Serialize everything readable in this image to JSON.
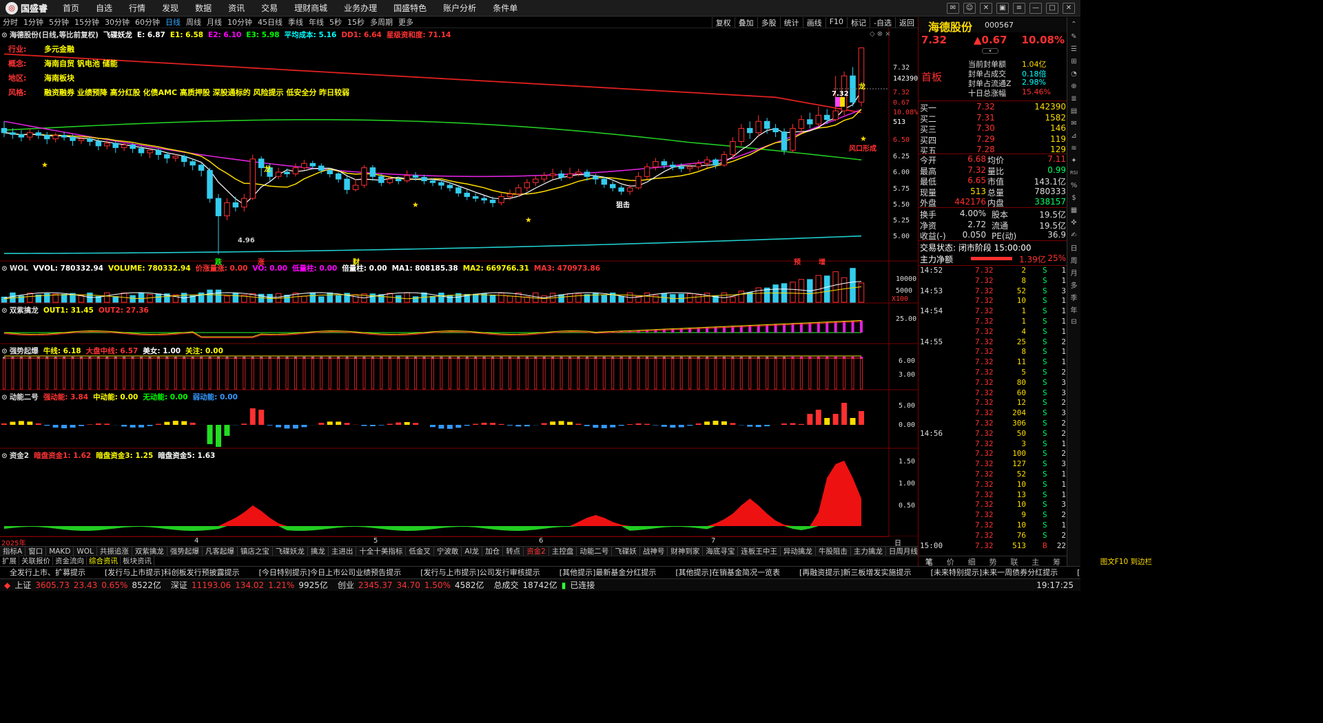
{
  "app": {
    "logo_text": "国盛睿"
  },
  "menu": [
    "首页",
    "自选",
    "行情",
    "发现",
    "数据",
    "资讯",
    "交易",
    "理财商城",
    "业务办理",
    "国盛特色",
    "账户分析",
    "条件单"
  ],
  "periods": [
    "分时",
    "1分钟",
    "5分钟",
    "15分钟",
    "30分钟",
    "60分钟",
    "日线",
    "周线",
    "月线",
    "10分钟",
    "45日线",
    "季线",
    "年线",
    "5秒",
    "15秒",
    "多周期",
    "更多"
  ],
  "active_period": "日线",
  "toolbar": [
    "复权",
    "叠加",
    "多股",
    "统计",
    "画线",
    "F10",
    "标记",
    "-自选",
    "返回"
  ],
  "main_panel": {
    "title_items": [
      {
        "text": "海德股份(日线,等比前复权)",
        "color": "#dddddd"
      },
      {
        "text": "飞碟妖龙",
        "color": "#ffffff"
      },
      {
        "text": "E: 6.87",
        "color": "#ffffff"
      },
      {
        "text": "E1: 6.58",
        "color": "#ffff00"
      },
      {
        "text": "E2: 6.10",
        "color": "#ff00ff"
      },
      {
        "text": "E3: 5.98",
        "color": "#00ff00"
      },
      {
        "text": "平均成本: 5.16",
        "color": "#00ffff"
      },
      {
        "text": "DD1: 6.64",
        "color": "#ff3333"
      },
      {
        "text": "星级资和度: 71.14",
        "color": "#ff3333"
      }
    ],
    "info": [
      {
        "k": "行业:",
        "v": "多元金融"
      },
      {
        "k": "概念:",
        "v": "海南自贸 钒电池 储能"
      },
      {
        "k": "地区:",
        "v": "海南板块"
      },
      {
        "k": "风格:",
        "v": "融资融券 业绩预降 高分红股 化债AMC 高质押股 深股通标的 风险提示 低安全分 昨日较弱"
      }
    ],
    "y_ticks": [
      "7.32",
      "142390",
      "7.32",
      "0.67",
      "10.08%",
      "513",
      "6.50",
      "6.25",
      "6.00",
      "5.75",
      "5.50",
      "5.25",
      "5.00"
    ],
    "annotations": [
      "龙",
      "4.96",
      "7.32",
      "龙",
      "风口形成",
      "狙击",
      "跌",
      "涨",
      "财",
      "预",
      "增"
    ]
  },
  "volume_panel": {
    "title_items": [
      {
        "text": "WOL",
        "color": "#dddddd"
      },
      {
        "text": "VVOL: 780332.94",
        "color": "#ffffff"
      },
      {
        "text": "VOLUME: 780332.94",
        "color": "#ffff00"
      },
      {
        "text": "价涨量涨: 0.00",
        "color": "#ff3333"
      },
      {
        "text": "VO: 0.00",
        "color": "#ff00ff"
      },
      {
        "text": "低量柱: 0.00",
        "color": "#ff00ff"
      },
      {
        "text": "倍量柱: 0.00",
        "color": "#ffffff"
      },
      {
        "text": "MA1: 808185.38",
        "color": "#ffffff"
      },
      {
        "text": "MA2: 669766.31",
        "color": "#ffff00"
      },
      {
        "text": "MA3: 470973.86",
        "color": "#ff3333"
      }
    ],
    "y_ticks": [
      "10000",
      "5000",
      "X100"
    ]
  },
  "panel2": {
    "title_items": [
      {
        "text": "双紫擒龙",
        "color": "#dddddd"
      },
      {
        "text": "OUT1: 31.45",
        "color": "#ffff00"
      },
      {
        "text": "OUT2: 27.36",
        "color": "#ff3333"
      }
    ],
    "y_ticks": [
      "25.00"
    ]
  },
  "panel3": {
    "title_items": [
      {
        "text": "强势起爆",
        "color": "#dddddd"
      },
      {
        "text": "牛线: 6.18",
        "color": "#ffff00"
      },
      {
        "text": "大盘中线: 6.57",
        "color": "#ff3333"
      },
      {
        "text": "美女: 1.00",
        "color": "#ffffff"
      },
      {
        "text": "关注: 0.00",
        "color": "#ffff00"
      }
    ],
    "y_ticks": [
      "6.00",
      "3.00"
    ]
  },
  "panel4": {
    "title_items": [
      {
        "text": "动能二号",
        "color": "#dddddd"
      },
      {
        "text": "强动能: 3.84",
        "color": "#ff3333"
      },
      {
        "text": "中动能: 0.00",
        "color": "#ffff00"
      },
      {
        "text": "无动能: 0.00",
        "color": "#00ff00"
      },
      {
        "text": "弱动能: 0.00",
        "color": "#3399ff"
      }
    ],
    "y_ticks": [
      "5.00",
      "0.00"
    ]
  },
  "panel5": {
    "title_items": [
      {
        "text": "资金2",
        "color": "#dddddd"
      },
      {
        "text": "暗盘资金1: 1.62",
        "color": "#ff3333"
      },
      {
        "text": "暗盘资金3: 1.25",
        "color": "#ffff00"
      },
      {
        "text": "暗盘资金5: 1.63",
        "color": "#ffffff"
      }
    ],
    "y_ticks": [
      "1.50",
      "1.00",
      "0.50"
    ]
  },
  "date_axis": [
    "2025年",
    "4",
    "5",
    "6",
    "7",
    "日线"
  ],
  "indicator_tabs": [
    "指标A",
    "窗口",
    "MAKD",
    "WOL",
    "共振追涨",
    "双紫擒龙",
    "强势起爆",
    "凡客起爆",
    "镇店之宝",
    "飞碟妖龙",
    "擒龙",
    "主进出",
    "十全十美指标",
    "低金叉",
    "宁波敢",
    "AI龙",
    "加仓",
    "转点",
    "资金2",
    "主控盘",
    "动能二号",
    "飞碟妖",
    "战神号",
    "财神到家",
    "海底寻宝",
    "连板王中王",
    "异动擒龙",
    "牛股阻击",
    "主力擒龙",
    "日周月线共振",
    "指标B",
    "模板"
  ],
  "active_indicator_tab": "资金2",
  "indicator_tabs2": [
    "扩展",
    "关联报价",
    "资金流向",
    "综合资讯",
    "板块资讯"
  ],
  "active_indicator_tab2": "综合资讯",
  "news": [
    "全发行上市、扩募提示",
    "[发行与上市提示]科创板发行预披露提示",
    "[今日特别提示]今日上市公司业绩预告提示",
    "[发行与上市提示]公司发行审核提示",
    "[其他提示]最新基金分红提示",
    "[其他提示]在销基金简况一览表",
    "[再融资提示]新三板增发实施提示",
    "[未来特别提示]未来一周债券分红提示",
    "[今日特别提示]今日债"
  ],
  "news_right": "图文F10 到边栏",
  "status": {
    "sh_label": "上证",
    "sh_val": "3605.73",
    "sh_chg": "23.43",
    "sh_pct": "0.65%",
    "sh_amt": "8522亿",
    "sz_label": "深证",
    "sz_val": "11193.06",
    "sz_chg": "134.02",
    "sz_pct": "1.21%",
    "sz_amt": "9925亿",
    "cy_label": "创业",
    "cy_val": "2345.37",
    "cy_chg": "34.70",
    "cy_pct": "1.50%",
    "cy_amt": "4582亿",
    "total_label": "总成交",
    "total_val": "18742亿",
    "conn": "已连接",
    "time": "19:17:25"
  },
  "quote": {
    "name": "海德股份",
    "code": "000567",
    "price": "7.32",
    "change": "▲0.67",
    "pct": "10.08%",
    "tag": "首板",
    "seal": [
      {
        "k": "当前封单额",
        "v": "1.04亿"
      },
      {
        "k": "封单占成交",
        "v": "0.18倍"
      },
      {
        "k": "封单占流通Z",
        "v": "2.98%"
      },
      {
        "k": "十日总涨幅",
        "v": "15.46%"
      }
    ],
    "bids": [
      {
        "k": "买一",
        "p": "7.32",
        "v": "142390"
      },
      {
        "k": "买二",
        "p": "7.31",
        "v": "1582"
      },
      {
        "k": "买三",
        "p": "7.30",
        "v": "146"
      },
      {
        "k": "买四",
        "p": "7.29",
        "v": "119"
      },
      {
        "k": "买五",
        "p": "7.28",
        "v": "129"
      }
    ],
    "stats": [
      {
        "k1": "今开",
        "v1": "6.68",
        "k2": "均价",
        "v2": "7.11"
      },
      {
        "k1": "最高",
        "v1": "7.32",
        "k2": "量比",
        "v2": "0.99"
      },
      {
        "k1": "最低",
        "v1": "6.65",
        "k2": "市值",
        "v2": "143.1亿"
      },
      {
        "k1": "现量",
        "v1": "513",
        "k2": "总量",
        "v2": "780333"
      },
      {
        "k1": "外盘",
        "v1": "442176",
        "k2": "内盘",
        "v2": "338157"
      }
    ],
    "stats2": [
      {
        "k1": "换手",
        "v1": "4.00%",
        "k2": "股本",
        "v2": "19.5亿"
      },
      {
        "k1": "净资",
        "v1": "2.72",
        "k2": "流通",
        "v2": "19.5亿"
      },
      {
        "k1": "收益(-)",
        "v1": "0.050",
        "k2": "PE(动)",
        "v2": "36.9"
      }
    ],
    "trade_status": "交易状态: 闭市阶段 15:00:00",
    "main_net_label": "主力净额",
    "main_net_val": "1.39亿",
    "main_net_pct": "25%",
    "ticks": [
      {
        "t": "14:52",
        "p": "7.32",
        "v": "2",
        "s": "S",
        "n": "1"
      },
      {
        "t": "",
        "p": "7.32",
        "v": "8",
        "s": "S",
        "n": "1"
      },
      {
        "t": "14:53",
        "p": "7.32",
        "v": "52",
        "s": "S",
        "n": "3"
      },
      {
        "t": "",
        "p": "7.32",
        "v": "10",
        "s": "S",
        "n": "1"
      },
      {
        "t": "14:54",
        "p": "7.32",
        "v": "1",
        "s": "S",
        "n": "1"
      },
      {
        "t": "",
        "p": "7.32",
        "v": "1",
        "s": "S",
        "n": "1"
      },
      {
        "t": "",
        "p": "7.32",
        "v": "4",
        "s": "S",
        "n": "1"
      },
      {
        "t": "14:55",
        "p": "7.32",
        "v": "25",
        "s": "S",
        "n": "2"
      },
      {
        "t": "",
        "p": "7.32",
        "v": "8",
        "s": "S",
        "n": "1"
      },
      {
        "t": "",
        "p": "7.32",
        "v": "11",
        "s": "S",
        "n": "1"
      },
      {
        "t": "",
        "p": "7.32",
        "v": "5",
        "s": "S",
        "n": "2"
      },
      {
        "t": "",
        "p": "7.32",
        "v": "80",
        "s": "S",
        "n": "3"
      },
      {
        "t": "",
        "p": "7.32",
        "v": "60",
        "s": "S",
        "n": "3"
      },
      {
        "t": "",
        "p": "7.32",
        "v": "12",
        "s": "S",
        "n": "2"
      },
      {
        "t": "",
        "p": "7.32",
        "v": "204",
        "s": "S",
        "n": "3"
      },
      {
        "t": "",
        "p": "7.32",
        "v": "306",
        "s": "S",
        "n": "2"
      },
      {
        "t": "14:56",
        "p": "7.32",
        "v": "50",
        "s": "S",
        "n": "2"
      },
      {
        "t": "",
        "p": "7.32",
        "v": "3",
        "s": "S",
        "n": "1"
      },
      {
        "t": "",
        "p": "7.32",
        "v": "100",
        "s": "S",
        "n": "2"
      },
      {
        "t": "",
        "p": "7.32",
        "v": "127",
        "s": "S",
        "n": "3"
      },
      {
        "t": "",
        "p": "7.32",
        "v": "52",
        "s": "S",
        "n": "1"
      },
      {
        "t": "",
        "p": "7.32",
        "v": "10",
        "s": "S",
        "n": "1"
      },
      {
        "t": "",
        "p": "7.32",
        "v": "13",
        "s": "S",
        "n": "1"
      },
      {
        "t": "",
        "p": "7.32",
        "v": "10",
        "s": "S",
        "n": "3"
      },
      {
        "t": "",
        "p": "7.32",
        "v": "9",
        "s": "S",
        "n": "2"
      },
      {
        "t": "",
        "p": "7.32",
        "v": "10",
        "s": "S",
        "n": "1"
      },
      {
        "t": "",
        "p": "7.32",
        "v": "76",
        "s": "S",
        "n": "2"
      },
      {
        "t": "15:00",
        "p": "7.32",
        "v": "513",
        "s": "B",
        "n": "22"
      }
    ],
    "bottom_tabs": [
      "笔",
      "价",
      "细",
      "势",
      "联",
      "主",
      "筹"
    ]
  },
  "side_buttons": [
    "⌃",
    "✎",
    "☰",
    "⊞",
    "◔",
    "⊕",
    "≣",
    "▤",
    "✉",
    "⊿",
    "≋",
    "✦",
    "RSI",
    "%",
    "$",
    "▦",
    "✜",
    "✍",
    "日",
    "周",
    "月",
    "多",
    "季",
    "年",
    "⊟"
  ],
  "chart_data": {
    "type": "candlestick",
    "ylim": [
      4.9,
      7.45
    ],
    "ma_series": [
      {
        "name": "E1",
        "color": "#ffff00"
      },
      {
        "name": "E2",
        "color": "#ff00ff"
      },
      {
        "name": "E3",
        "color": "#00ff00"
      },
      {
        "name": "平均成本",
        "color": "#00ffff"
      }
    ],
    "candles": [
      [
        6.4,
        6.35,
        6.48,
        6.3
      ],
      [
        6.35,
        6.33,
        6.4,
        6.28
      ],
      [
        6.33,
        6.3,
        6.38,
        6.25
      ],
      [
        6.3,
        6.35,
        6.4,
        6.26
      ],
      [
        6.35,
        6.32,
        6.38,
        6.28
      ],
      [
        6.32,
        6.28,
        6.36,
        6.22
      ],
      [
        6.28,
        6.32,
        6.35,
        6.24
      ],
      [
        6.32,
        6.3,
        6.36,
        6.26
      ],
      [
        6.3,
        6.26,
        6.33,
        6.2
      ],
      [
        6.26,
        6.28,
        6.32,
        6.22
      ],
      [
        6.28,
        6.25,
        6.3,
        6.2
      ],
      [
        6.25,
        6.2,
        6.28,
        6.15
      ],
      [
        6.2,
        6.23,
        6.26,
        6.16
      ],
      [
        6.23,
        6.18,
        6.25,
        6.12
      ],
      [
        6.18,
        6.21,
        6.24,
        6.14
      ],
      [
        6.21,
        6.17,
        6.23,
        6.12
      ],
      [
        6.17,
        6.12,
        6.2,
        6.08
      ],
      [
        6.12,
        6.15,
        6.18,
        6.06
      ],
      [
        6.15,
        6.1,
        6.17,
        6.04
      ],
      [
        6.1,
        6.06,
        6.13,
        6.0
      ],
      [
        6.06,
        6.08,
        6.11,
        6.02
      ],
      [
        6.08,
        6.02,
        6.1,
        5.96
      ],
      [
        6.02,
        5.98,
        6.05,
        5.92
      ],
      [
        5.98,
        5.92,
        6.0,
        5.85
      ],
      [
        5.92,
        5.6,
        5.95,
        5.55
      ],
      [
        5.6,
        5.4,
        5.65,
        4.96
      ],
      [
        5.4,
        5.55,
        5.6,
        5.35
      ],
      [
        5.55,
        5.5,
        5.62,
        5.45
      ],
      [
        5.5,
        5.6,
        5.65,
        5.45
      ],
      [
        5.6,
        6.05,
        6.1,
        5.58
      ],
      [
        6.05,
        5.95,
        6.08,
        5.85
      ],
      [
        5.95,
        5.85,
        6.0,
        5.8
      ],
      [
        5.85,
        5.9,
        5.95,
        5.82
      ],
      [
        5.9,
        5.88,
        5.94,
        5.84
      ],
      [
        5.88,
        5.95,
        6.0,
        5.85
      ],
      [
        5.95,
        6.0,
        6.04,
        5.92
      ],
      [
        6.0,
        5.97,
        6.03,
        5.93
      ],
      [
        5.97,
        5.92,
        6.0,
        5.88
      ],
      [
        5.92,
        5.88,
        5.95,
        5.84
      ],
      [
        5.88,
        5.82,
        5.9,
        5.78
      ],
      [
        5.82,
        5.7,
        5.85,
        5.65
      ],
      [
        5.7,
        5.75,
        5.82,
        5.68
      ],
      [
        5.75,
        5.95,
        5.98,
        5.72
      ],
      [
        5.95,
        5.85,
        5.98,
        5.8
      ],
      [
        5.85,
        5.78,
        5.88,
        5.74
      ],
      [
        5.78,
        5.82,
        5.86,
        5.76
      ],
      [
        5.82,
        5.8,
        5.85,
        5.76
      ],
      [
        5.8,
        5.86,
        5.92,
        5.78
      ],
      [
        5.86,
        5.84,
        5.9,
        5.8
      ],
      [
        5.84,
        5.8,
        5.87,
        5.76
      ],
      [
        5.8,
        5.78,
        5.83,
        5.74
      ],
      [
        5.78,
        5.75,
        5.81,
        5.7
      ],
      [
        5.75,
        5.72,
        5.78,
        5.68
      ],
      [
        5.72,
        5.66,
        5.75,
        5.62
      ],
      [
        5.66,
        5.62,
        5.7,
        5.58
      ],
      [
        5.62,
        5.6,
        5.66,
        5.56
      ],
      [
        5.6,
        5.58,
        5.63,
        5.54
      ],
      [
        5.58,
        5.55,
        5.62,
        5.5
      ],
      [
        5.55,
        5.62,
        5.66,
        5.52
      ],
      [
        5.62,
        5.65,
        5.7,
        5.58
      ],
      [
        5.65,
        5.72,
        5.76,
        5.62
      ],
      [
        5.72,
        5.78,
        5.82,
        5.68
      ],
      [
        5.78,
        5.82,
        5.86,
        5.74
      ],
      [
        5.82,
        5.86,
        5.9,
        5.78
      ],
      [
        5.86,
        5.88,
        5.94,
        5.82
      ],
      [
        5.88,
        5.84,
        5.92,
        5.8
      ],
      [
        5.84,
        5.88,
        5.95,
        5.82
      ],
      [
        5.88,
        5.9,
        5.94,
        5.85
      ],
      [
        5.9,
        5.85,
        5.93,
        5.8
      ],
      [
        5.85,
        5.82,
        5.88,
        5.76
      ],
      [
        5.82,
        5.76,
        5.85,
        5.72
      ],
      [
        5.76,
        5.72,
        5.8,
        5.68
      ],
      [
        5.72,
        5.68,
        5.75,
        5.64
      ],
      [
        5.68,
        5.72,
        5.76,
        5.64
      ],
      [
        5.72,
        5.85,
        5.9,
        5.7
      ],
      [
        5.85,
        5.96,
        6.0,
        5.82
      ],
      [
        5.96,
        6.02,
        6.06,
        5.92
      ],
      [
        6.02,
        5.98,
        6.05,
        5.94
      ],
      [
        5.98,
        5.96,
        6.02,
        5.92
      ],
      [
        5.96,
        5.94,
        6.0,
        5.9
      ],
      [
        5.94,
        5.96,
        6.0,
        5.9
      ],
      [
        5.96,
        6.0,
        6.04,
        5.92
      ],
      [
        6.0,
        6.04,
        6.08,
        5.95
      ],
      [
        6.04,
        5.98,
        6.06,
        5.94
      ],
      [
        5.98,
        6.1,
        6.14,
        5.96
      ],
      [
        6.1,
        6.25,
        6.3,
        6.05
      ],
      [
        6.25,
        6.4,
        6.45,
        6.2
      ],
      [
        6.4,
        6.35,
        6.48,
        6.28
      ],
      [
        6.35,
        6.48,
        6.55,
        6.3
      ],
      [
        6.48,
        6.4,
        6.52,
        6.34
      ],
      [
        6.4,
        6.36,
        6.45,
        6.3
      ],
      [
        6.36,
        6.15,
        6.4,
        6.1
      ],
      [
        6.15,
        6.4,
        6.45,
        6.12
      ],
      [
        6.4,
        6.5,
        6.55,
        6.35
      ],
      [
        6.5,
        6.45,
        6.58,
        6.4
      ],
      [
        6.45,
        6.55,
        6.65,
        6.42
      ],
      [
        6.55,
        6.5,
        6.62,
        6.45
      ],
      [
        6.5,
        6.6,
        7.0,
        6.48
      ],
      [
        6.6,
        7.0,
        7.05,
        6.55
      ],
      [
        7.0,
        6.7,
        7.1,
        6.65
      ],
      [
        6.7,
        7.32,
        7.32,
        6.65
      ]
    ]
  }
}
